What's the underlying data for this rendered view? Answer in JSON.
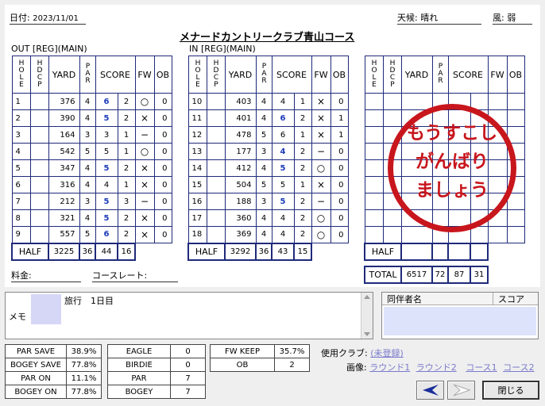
{
  "header": {
    "date_label": "日付:",
    "date": "2023/11/01",
    "weather_label": "天候:",
    "weather": "晴れ",
    "wind_label": "風:",
    "wind": "弱",
    "course_name": "メナードカントリークラブ青山コース"
  },
  "out_label": "OUT [REG](MAIN)",
  "in_label": "IN [REG](MAIN)",
  "col_headers": {
    "hole": "HOLE",
    "hdcp": "HDCP",
    "yard": "YARD",
    "par": "PAR",
    "score": "SCORE",
    "fw": "FW",
    "ob": "OB"
  },
  "out_holes": [
    {
      "hole": "1",
      "yard": "376",
      "par": "4",
      "score": "6",
      "putt": "2",
      "fw": "○",
      "ob": "0"
    },
    {
      "hole": "2",
      "yard": "390",
      "par": "4",
      "score": "5",
      "putt": "2",
      "fw": "×",
      "ob": "0"
    },
    {
      "hole": "3",
      "yard": "164",
      "par": "3",
      "score": "3",
      "putt": "1",
      "fw": "−",
      "ob": "0"
    },
    {
      "hole": "4",
      "yard": "542",
      "par": "5",
      "score": "5",
      "putt": "1",
      "fw": "○",
      "ob": "0"
    },
    {
      "hole": "5",
      "yard": "347",
      "par": "4",
      "score": "5",
      "putt": "2",
      "fw": "×",
      "ob": "0"
    },
    {
      "hole": "6",
      "yard": "316",
      "par": "4",
      "score": "4",
      "putt": "1",
      "fw": "×",
      "ob": "0"
    },
    {
      "hole": "7",
      "yard": "212",
      "par": "3",
      "score": "5",
      "putt": "3",
      "fw": "−",
      "ob": "0"
    },
    {
      "hole": "8",
      "yard": "321",
      "par": "4",
      "score": "5",
      "putt": "2",
      "fw": "×",
      "ob": "0"
    },
    {
      "hole": "9",
      "yard": "557",
      "par": "5",
      "score": "6",
      "putt": "2",
      "fw": "×",
      "ob": "0"
    }
  ],
  "in_holes": [
    {
      "hole": "10",
      "yard": "403",
      "par": "4",
      "score": "4",
      "putt": "1",
      "fw": "×",
      "ob": "0"
    },
    {
      "hole": "11",
      "yard": "401",
      "par": "4",
      "score": "6",
      "putt": "2",
      "fw": "×",
      "ob": "1"
    },
    {
      "hole": "12",
      "yard": "478",
      "par": "5",
      "score": "6",
      "putt": "1",
      "fw": "×",
      "ob": "1"
    },
    {
      "hole": "13",
      "yard": "177",
      "par": "3",
      "score": "4",
      "putt": "2",
      "fw": "−",
      "ob": "0"
    },
    {
      "hole": "14",
      "yard": "412",
      "par": "4",
      "score": "5",
      "putt": "2",
      "fw": "○",
      "ob": "0"
    },
    {
      "hole": "15",
      "yard": "504",
      "par": "5",
      "score": "5",
      "putt": "1",
      "fw": "×",
      "ob": "0"
    },
    {
      "hole": "16",
      "yard": "188",
      "par": "3",
      "score": "5",
      "putt": "2",
      "fw": "−",
      "ob": "0"
    },
    {
      "hole": "17",
      "yard": "360",
      "par": "4",
      "score": "4",
      "putt": "2",
      "fw": "○",
      "ob": "0"
    },
    {
      "hole": "18",
      "yard": "369",
      "par": "4",
      "score": "4",
      "putt": "2",
      "fw": "○",
      "ob": "0"
    }
  ],
  "out_half": {
    "label": "HALF",
    "yard": "3225",
    "par": "36",
    "score": "44",
    "putt": "16"
  },
  "in_half": {
    "label": "HALF",
    "yard": "3292",
    "par": "36",
    "score": "43",
    "putt": "15"
  },
  "right_half_label": "HALF",
  "total": {
    "label": "TOTAL",
    "yard": "6517",
    "par": "72",
    "score": "87",
    "putt": "31"
  },
  "stamp_lines": [
    "もうすこし",
    "がんばり",
    "ましょう"
  ],
  "fee_label": "料金:",
  "course_rate_label": "コースレート:",
  "memo": {
    "label": "メモ",
    "text": "旅行　1日目"
  },
  "companions": {
    "name_header": "同伴者名",
    "score_header": "スコア"
  },
  "stats1": [
    [
      "PAR SAVE",
      "38.9%"
    ],
    [
      "BOGEY SAVE",
      "77.8%"
    ],
    [
      "PAR ON",
      "11.1%"
    ],
    [
      "BOGEY ON",
      "77.8%"
    ]
  ],
  "stats2": [
    [
      "EAGLE",
      "0"
    ],
    [
      "BIRDIE",
      "0"
    ],
    [
      "PAR",
      "7"
    ],
    [
      "BOGEY",
      "7"
    ]
  ],
  "stats3": [
    [
      "FW KEEP",
      "35.7%"
    ],
    [
      "OB",
      "2"
    ]
  ],
  "club_label": "使用クラブ:",
  "club_value": "(未登録)",
  "image_label": "画像:",
  "image_links": [
    "ラウンド1",
    "ラウンド2",
    "コース1",
    "コース2"
  ],
  "close_label": "閉じる",
  "colors": {
    "grid": "#1f2a7a",
    "stamp": "#c8161d",
    "good_score": "#1a3ab8"
  }
}
